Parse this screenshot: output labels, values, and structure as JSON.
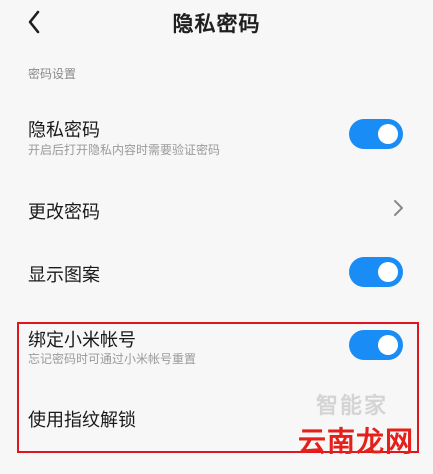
{
  "header": {
    "title": "隐私密码",
    "back_icon": "chevron-left-icon"
  },
  "section": {
    "title": "密码设置"
  },
  "rows": [
    {
      "label": "隐私密码",
      "sublabel": "开启后打开隐私内容时需要验证密码",
      "control": "toggle",
      "value": true
    },
    {
      "label": "更改密码",
      "control": "chevron"
    },
    {
      "label": "显示图案",
      "control": "toggle",
      "value": true
    },
    {
      "label": "绑定小米帐号",
      "sublabel": "忘记密码时可通过小米帐号重置",
      "control": "toggle",
      "value": true
    },
    {
      "label": "使用指纹解锁",
      "control": "none"
    }
  ],
  "colors": {
    "accent": "#1a8cf5",
    "highlight": "#e0151f"
  },
  "watermark": {
    "icon_text": "智能家",
    "text": "云南龙网"
  }
}
